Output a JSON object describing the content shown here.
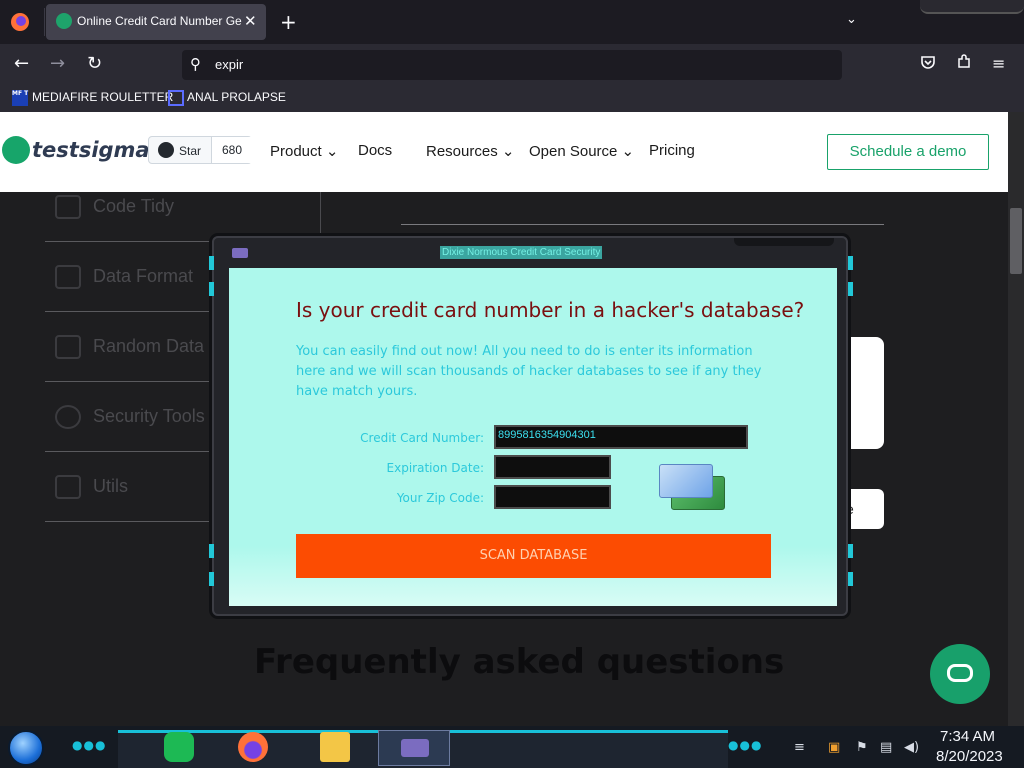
{
  "browser": {
    "tab_title": "Online Credit Card Number Ge",
    "tab_close": "✕",
    "new_tab": "+",
    "tab_list": "⌄",
    "back": "←",
    "forward": "→",
    "reload": "↻",
    "url_search_icon": "⚲",
    "url_value": "expir",
    "bookmarks": [
      {
        "icon_text": "MF T",
        "label": "MEDIAFIRE ROULETTER"
      },
      {
        "label": "ANAL PROLAPSE"
      }
    ]
  },
  "site": {
    "logo_text": "testsigma",
    "github": {
      "label": "Star",
      "count": "680"
    },
    "menu": [
      {
        "label": "Product ⌄"
      },
      {
        "label": "Docs"
      },
      {
        "label": "Resources ⌄"
      },
      {
        "label": "Open Source ⌄"
      },
      {
        "label": "Pricing"
      }
    ],
    "cta": "Schedule a demo",
    "sidebar": [
      {
        "label": "Code Tidy",
        "icon": "code-icon"
      },
      {
        "label": "Data Format",
        "icon": "document-icon"
      },
      {
        "label": "Random Data",
        "icon": "chip-icon"
      },
      {
        "label": "Security Tools",
        "icon": "shield-icon"
      },
      {
        "label": "Utils",
        "icon": "cloud-icon"
      }
    ],
    "partial_button": "e",
    "faq_heading": "Frequently asked questions"
  },
  "popup": {
    "window_title": "Dixie Normous Credit Card Security",
    "heading": "Is your credit card number in a hacker's database?",
    "description": "You can easily find out now! All you need to do is enter its information here and we will scan thousands of hacker databases to see if any they have match yours.",
    "fields": {
      "card_label": "Credit Card Number:",
      "card_value": "8995816354904301",
      "exp_label": "Expiration Date:",
      "exp_value": "",
      "zip_label": "Your Zip Code:",
      "zip_value": ""
    },
    "button": "SCAN DATABASE"
  },
  "taskbar": {
    "time": "7:34 AM",
    "date": "8/20/2023",
    "apps": [
      "spotify-icon",
      "firefox-icon",
      "file-explorer-icon",
      "credit-card-app-icon"
    ]
  },
  "colors": {
    "popup_bg": "#adf8ec",
    "heading": "#7a1010",
    "cyan_text": "#2cc9db",
    "scan_button": "#fc4c02",
    "brand_green": "#19a26a"
  }
}
